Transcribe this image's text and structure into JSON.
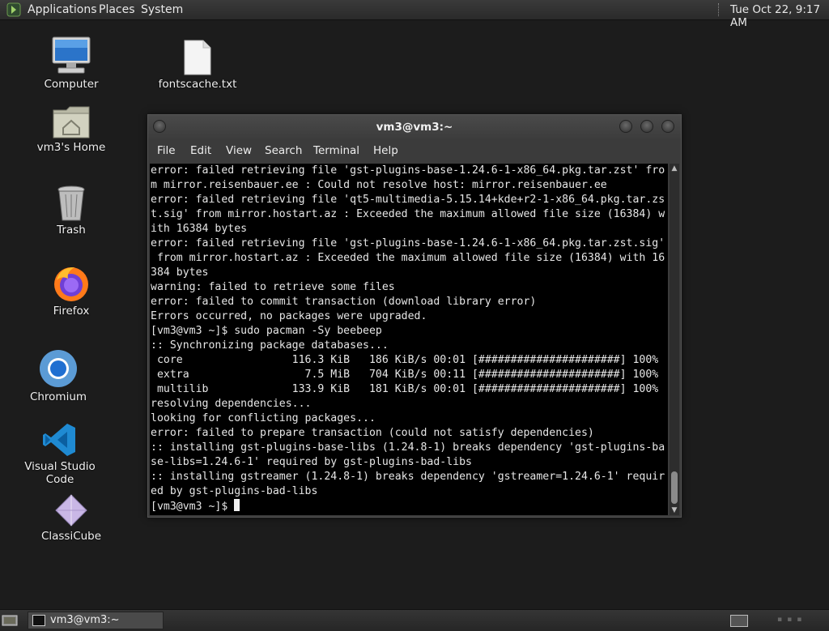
{
  "top_panel": {
    "menus": [
      "Applications",
      "Places",
      "System"
    ],
    "clock": "Tue Oct 22,  9:17 AM"
  },
  "desktop_icons": [
    {
      "label": "Computer",
      "icon": "computer-icon"
    },
    {
      "label": "fontscache.txt",
      "icon": "text-file-icon"
    },
    {
      "label": "vm3's Home",
      "icon": "home-folder-icon"
    },
    {
      "label": "Trash",
      "icon": "trash-icon"
    },
    {
      "label": "Firefox",
      "icon": "firefox-icon"
    },
    {
      "label": "Chromium",
      "icon": "chromium-icon"
    },
    {
      "label": "Visual Studio Code",
      "icon": "vscode-icon"
    },
    {
      "label": "ClassiCube",
      "icon": "classicube-icon"
    }
  ],
  "terminal": {
    "title": "vm3@vm3:~",
    "menu": [
      "File",
      "Edit",
      "View",
      "Search",
      "Terminal",
      "Help"
    ],
    "lines": [
      "error: failed retrieving file 'gst-plugins-base-1.24.6-1-x86_64.pkg.tar.zst' fro",
      "m mirror.reisenbauer.ee : Could not resolve host: mirror.reisenbauer.ee",
      "error: failed retrieving file 'qt5-multimedia-5.15.14+kde+r2-1-x86_64.pkg.tar.zs",
      "t.sig' from mirror.hostart.az : Exceeded the maximum allowed file size (16384) w",
      "ith 16384 bytes",
      "error: failed retrieving file 'gst-plugins-base-1.24.6-1-x86_64.pkg.tar.zst.sig'",
      " from mirror.hostart.az : Exceeded the maximum allowed file size (16384) with 16",
      "384 bytes",
      "warning: failed to retrieve some files",
      "error: failed to commit transaction (download library error)",
      "Errors occurred, no packages were upgraded.",
      "[vm3@vm3 ~]$ sudo pacman -Sy beebeep",
      ":: Synchronizing package databases...",
      " core                 116.3 KiB   186 KiB/s 00:01 [######################] 100%",
      " extra                  7.5 MiB   704 KiB/s 00:11 [######################] 100%",
      " multilib             133.9 KiB   181 KiB/s 00:01 [######################] 100%",
      "resolving dependencies...",
      "looking for conflicting packages...",
      "error: failed to prepare transaction (could not satisfy dependencies)",
      ":: installing gst-plugins-base-libs (1.24.8-1) breaks dependency 'gst-plugins-ba",
      "se-libs=1.24.6-1' required by gst-plugins-bad-libs",
      ":: installing gstreamer (1.24.8-1) breaks dependency 'gstreamer=1.24.6-1' requir",
      "ed by gst-plugins-bad-libs"
    ],
    "prompt": "[vm3@vm3 ~]$ "
  },
  "taskbar": {
    "window_button": "vm3@vm3:~"
  }
}
